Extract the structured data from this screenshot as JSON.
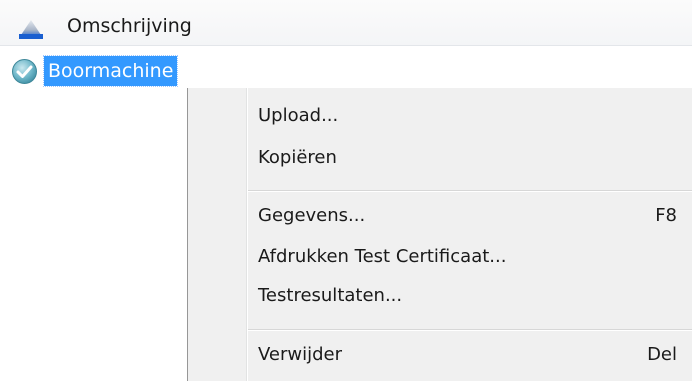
{
  "header": {
    "column_label": "Omschrijving",
    "sort_icon": "sort-ascending-icon"
  },
  "tree": {
    "selected_item": {
      "label": "Boormachine",
      "status_icon": "check-circle-icon",
      "status_color": "#5fb3c9"
    }
  },
  "context_menu": {
    "groups": [
      {
        "items": [
          {
            "label": "Upload...",
            "shortcut": ""
          },
          {
            "label": "Kopiëren",
            "shortcut": ""
          }
        ]
      },
      {
        "items": [
          {
            "label": "Gegevens...",
            "shortcut": "F8"
          },
          {
            "label": "Afdrukken Test Certificaat...",
            "shortcut": ""
          },
          {
            "label": "Testresultaten...",
            "shortcut": ""
          }
        ]
      },
      {
        "items": [
          {
            "label": "Verwijder",
            "shortcut": "Del"
          }
        ]
      }
    ]
  },
  "colors": {
    "selection": "#3399ff",
    "menu_background": "#f0f0f0",
    "sort_icon_blue": "#1a5fd0"
  }
}
